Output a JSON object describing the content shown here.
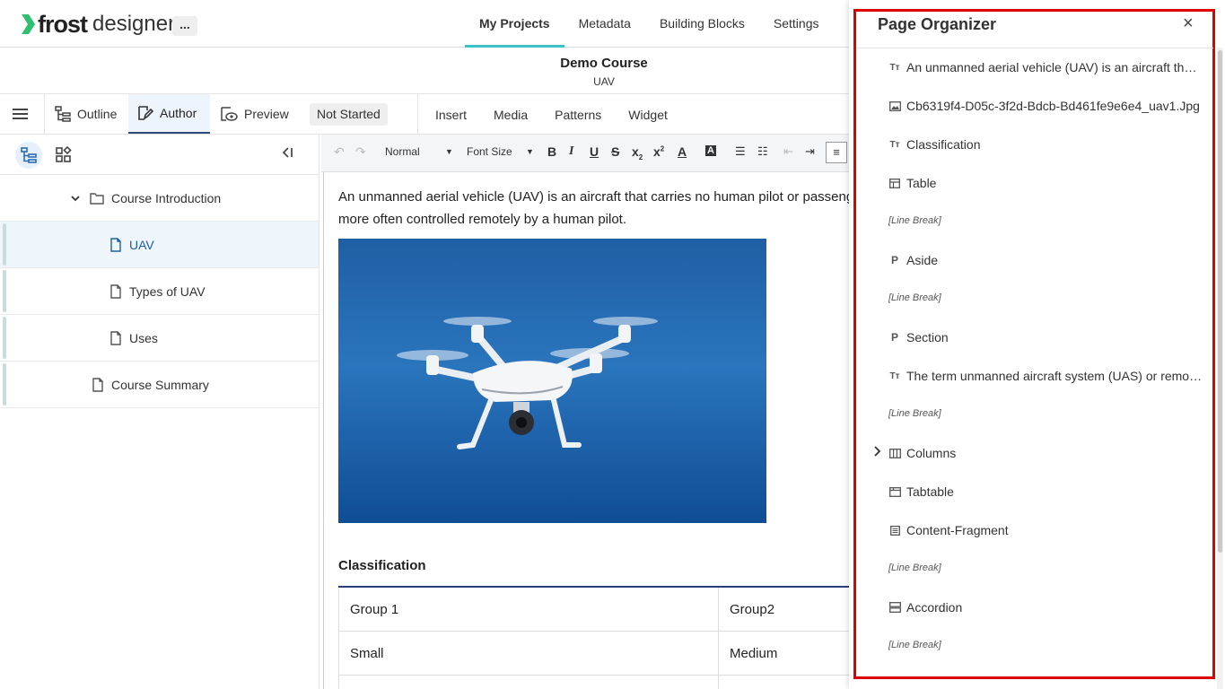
{
  "app": {
    "brand_name": "frost",
    "brand_sub": "designer",
    "more_label": "...",
    "accent": "#3fc1c9"
  },
  "nav": {
    "tabs": [
      {
        "label": "My Projects",
        "active": true
      },
      {
        "label": "Metadata"
      },
      {
        "label": "Building Blocks"
      },
      {
        "label": "Settings"
      }
    ]
  },
  "course": {
    "title": "Demo Course",
    "page": "UAV"
  },
  "modes": {
    "outline": "Outline",
    "author": "Author",
    "preview": "Preview",
    "status": "Not Started"
  },
  "insert_tabs": [
    "Insert",
    "Media",
    "Patterns",
    "Widget"
  ],
  "tree": {
    "items": [
      {
        "label": "Course Introduction",
        "type": "folder"
      },
      {
        "label": "UAV",
        "type": "page",
        "selected": true
      },
      {
        "label": "Types of UAV",
        "type": "page"
      },
      {
        "label": "Uses",
        "type": "page"
      },
      {
        "label": "Course Summary",
        "type": "page"
      }
    ]
  },
  "editor": {
    "format_select": "Normal",
    "font_size_select": "Font Size",
    "paragraph": "An unmanned aerial vehicle (UAV) is an aircraft that carries no human pilot or passengers. UAVs can be partially autonomous but are more often controlled remotely by a human pilot.",
    "heading": "Classification",
    "table": [
      [
        "Group 1",
        "Group2"
      ],
      [
        "Small",
        "Medium"
      ]
    ]
  },
  "organizer": {
    "title": "Page Organizer",
    "close_label": "×",
    "items": [
      {
        "icon": "text-icon",
        "label": "An unmanned aerial vehicle (UAV) is an aircraft that ..."
      },
      {
        "icon": "image-icon",
        "label": "Cb6319f4-D05c-3f2d-Bdcb-Bd461fe9e6e4_uav1.Jpg"
      },
      {
        "icon": "text-icon",
        "label": "Classification"
      },
      {
        "icon": "table-icon",
        "label": "Table"
      },
      {
        "icon": "line-break",
        "label": "[Line Break]"
      },
      {
        "icon": "paragraph-icon",
        "label": "Aside"
      },
      {
        "icon": "line-break",
        "label": "[Line Break]"
      },
      {
        "icon": "paragraph-icon",
        "label": "Section"
      },
      {
        "icon": "text-icon",
        "label": "The term unmanned aircraft system (UAS) or remote..."
      },
      {
        "icon": "line-break",
        "label": "[Line Break]"
      },
      {
        "icon": "columns-icon",
        "label": "Columns",
        "expandable": true
      },
      {
        "icon": "tabtable-icon",
        "label": "Tabtable"
      },
      {
        "icon": "fragment-icon",
        "label": "Content-Fragment"
      },
      {
        "icon": "line-break",
        "label": "[Line Break]"
      },
      {
        "icon": "accordion-icon",
        "label": "Accordion"
      },
      {
        "icon": "line-break",
        "label": "[Line Break]"
      }
    ]
  }
}
